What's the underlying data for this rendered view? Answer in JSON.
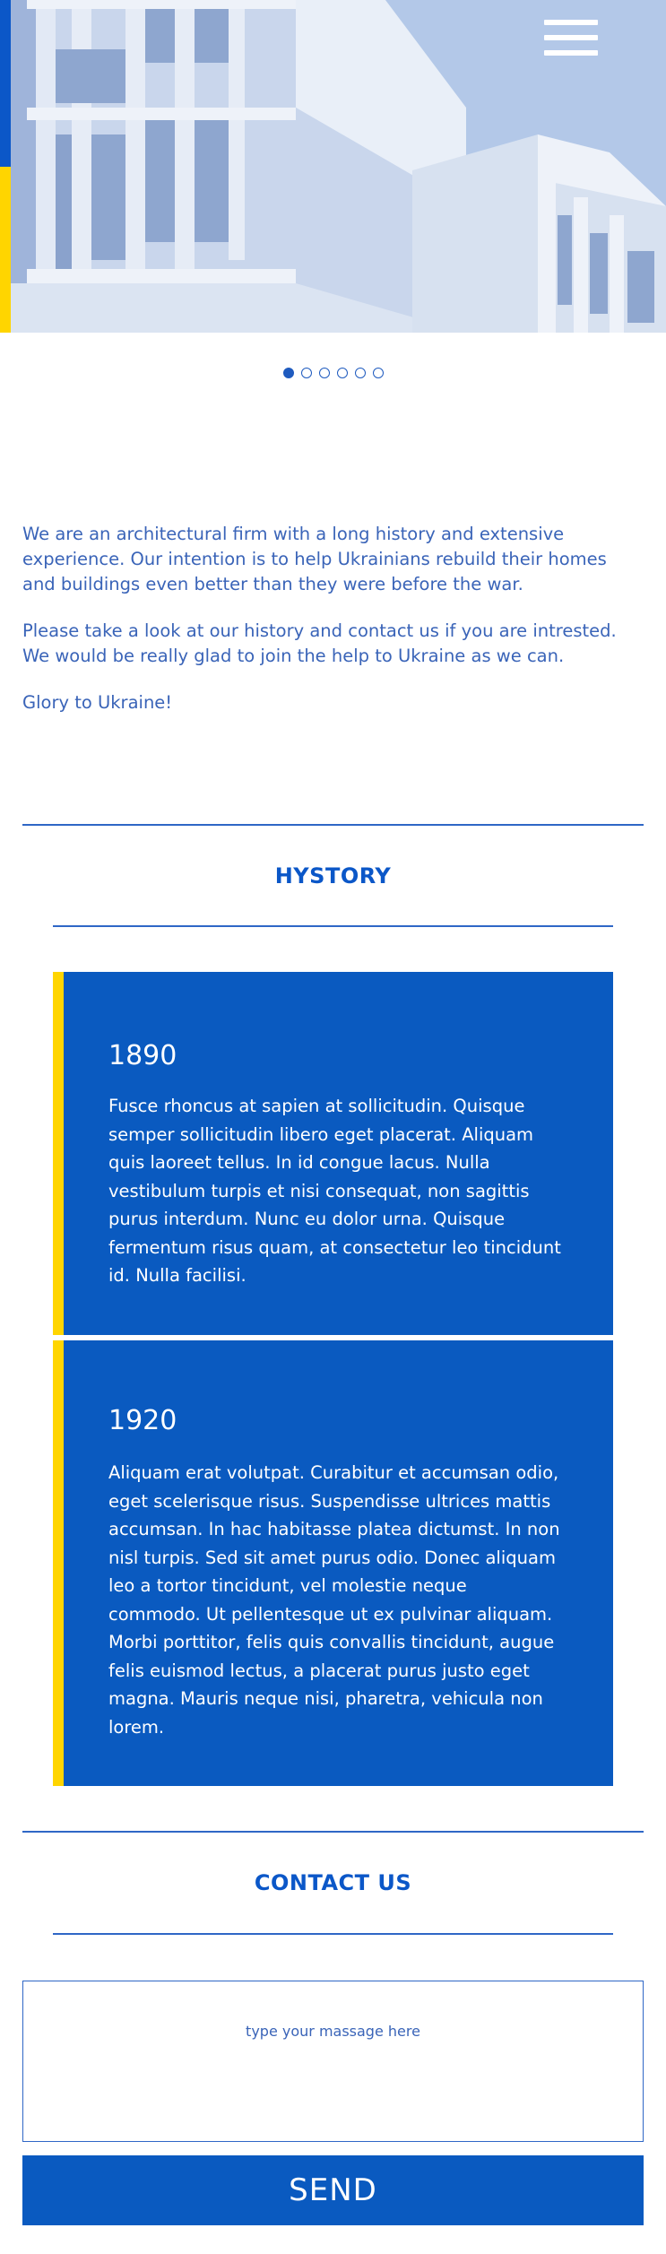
{
  "hero": {
    "image_description_icon": "building-photo",
    "menu_icon": "hamburger-menu-icon",
    "slides": 6,
    "active_slide": 1
  },
  "intro": {
    "paragraphs": [
      "We are an architectural firm with a long history and extensive experience. Our intention is to help Ukrainians rebuild their homes and buildings even better than they were before the war.",
      "Please take a look at our history and contact us if you are intrested. We would be really glad to join the help to Ukraine as we can.",
      "Glory to Ukraine!"
    ]
  },
  "history": {
    "title": "HYSTORY",
    "entries": [
      {
        "year": "1890",
        "text": "Fusce rhoncus at sapien at sollicitudin. Quisque semper sollicitudin libero eget placerat. Aliquam quis laoreet tellus. In id congue lacus. Nulla vestibulum turpis et nisi consequat, non sagittis purus interdum. Nunc eu dolor urna. Quisque fermentum risus quam, at consectetur leo tincidunt id. Nulla facilisi."
      },
      {
        "year": "1920",
        "text": "Aliquam erat volutpat. Curabitur et accumsan odio, eget scelerisque risus. Suspendisse ultrices mattis accumsan. In hac habitasse platea dictumst. In non nisl turpis. Sed sit amet purus odio. Donec aliquam leo a tortor tincidunt, vel molestie neque commodo. Ut pellentesque ut ex pulvinar aliquam. Morbi porttitor, felis quis convallis tincidunt, augue felis euismod lectus, a placerat purus justo eget magna. Mauris neque nisi, pharetra, vehicula non lorem."
      }
    ]
  },
  "contact": {
    "title": "CONTACT US",
    "message_placeholder": "type your massage here",
    "message_value": "",
    "send_label": "SEND"
  },
  "colors": {
    "brand_blue": "#0a5ac0",
    "brand_yellow": "#ffd500",
    "text_blue": "#3a64b8"
  }
}
